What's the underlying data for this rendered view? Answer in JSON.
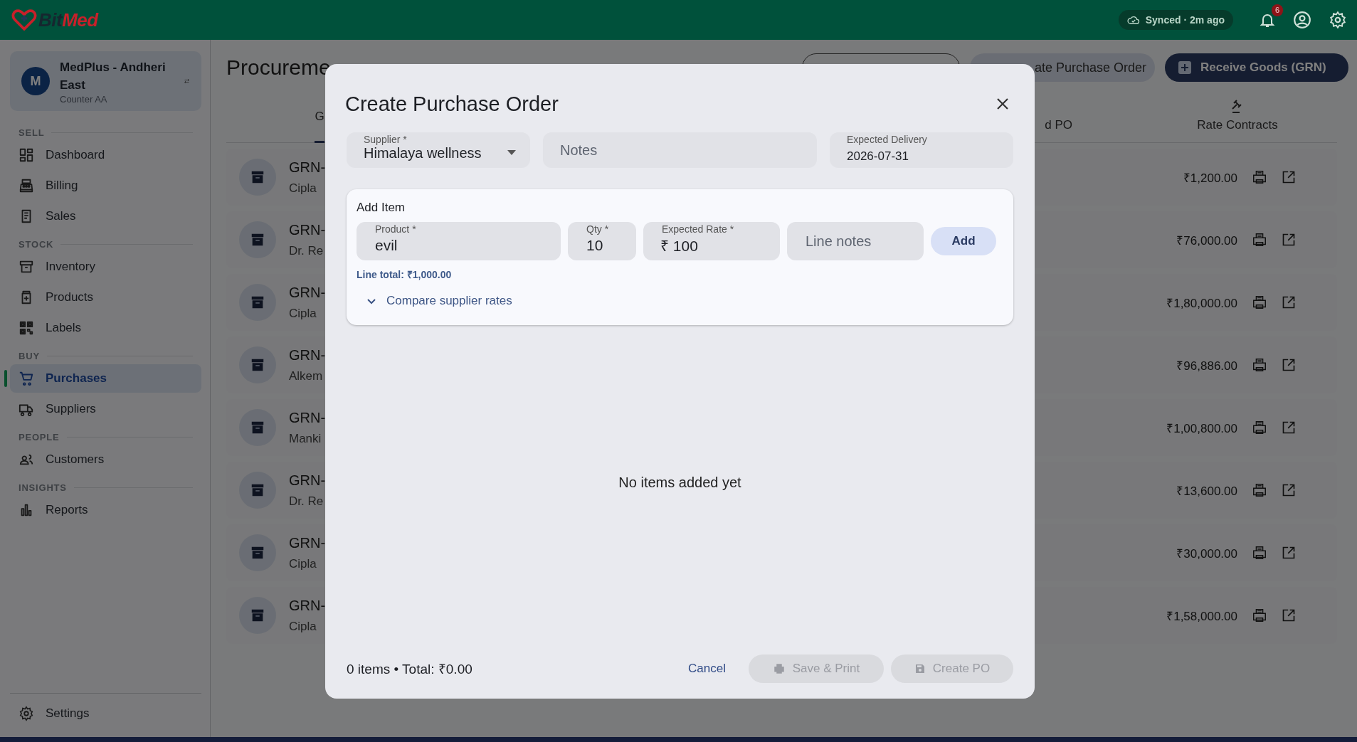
{
  "app_bar": {
    "logo": [
      "Bit",
      "Med"
    ],
    "sync_status": "Synced · 2m ago",
    "notification_count": "6"
  },
  "sidebar": {
    "store": {
      "avatar": "M",
      "name": "MedPlus - Andheri East",
      "counter": "Counter AA"
    },
    "sections": [
      {
        "title": "SELL",
        "items": [
          {
            "label": "Dashboard",
            "selected": false
          },
          {
            "label": "Billing",
            "selected": false
          },
          {
            "label": "Sales",
            "selected": false
          }
        ]
      },
      {
        "title": "STOCK",
        "items": [
          {
            "label": "Inventory",
            "selected": false
          },
          {
            "label": "Products",
            "selected": false
          },
          {
            "label": "Labels",
            "selected": false
          }
        ]
      },
      {
        "title": "BUY",
        "items": [
          {
            "label": "Purchases",
            "selected": true
          },
          {
            "label": "Suppliers",
            "selected": false
          }
        ]
      },
      {
        "title": "PEOPLE",
        "items": [
          {
            "label": "Customers",
            "selected": false
          }
        ]
      },
      {
        "title": "INSIGHTS",
        "items": [
          {
            "label": "Reports",
            "selected": false
          }
        ]
      }
    ],
    "footer_item": {
      "label": "Settings"
    }
  },
  "page": {
    "title": "Procureme",
    "actions": [
      {
        "kind": "outlined"
      },
      {
        "kind": "tonal",
        "label": "ate Purchase Order"
      },
      {
        "kind": "filled",
        "label": "Receive Goods (GRN)"
      }
    ]
  },
  "tabs": [
    {
      "label": "G",
      "selected": true
    },
    {
      "label": "d PO",
      "selected": false
    },
    {
      "label": "Rate Contracts",
      "selected": false
    }
  ],
  "rows": [
    {
      "number": "GRN-",
      "supplier": "Cipla",
      "amount": "₹1,200.00"
    },
    {
      "number": "GRN-",
      "supplier": "Dr. Re",
      "amount": "₹76,000.00"
    },
    {
      "number": "GRN-",
      "supplier": "Cipla",
      "amount": "₹1,80,000.00"
    },
    {
      "number": "GRN-",
      "supplier": "Alkem",
      "amount": "₹96,886.00"
    },
    {
      "number": "GRN-",
      "supplier": "Manki",
      "amount": "₹1,00,800.00"
    },
    {
      "number": "GRN-",
      "supplier": "Dr. Re",
      "amount": "₹13,600.00"
    },
    {
      "number": "GRN-",
      "supplier": "Cipla",
      "amount": "₹30,000.00"
    },
    {
      "number": "GRN-",
      "supplier": "Cipla",
      "amount": "₹1,58,000.00"
    }
  ],
  "dialog": {
    "title": "Create Purchase Order",
    "supplier": {
      "label": "Supplier *",
      "value": "Himalaya wellness"
    },
    "notes": {
      "placeholder": "Notes"
    },
    "expected_delivery": {
      "label": "Expected Delivery",
      "value": "2026-07-31"
    },
    "add_item": {
      "title": "Add Item",
      "product": {
        "label": "Product *",
        "value": "evil"
      },
      "qty": {
        "label": "Qty *",
        "value": "10"
      },
      "rate": {
        "label": "Expected Rate *",
        "prefix": "₹",
        "value": "100"
      },
      "line_notes": {
        "placeholder": "Line notes"
      },
      "add_button": "Add",
      "line_total": "Line total: ₹1,000.00",
      "compare_toggle": {
        "label": "Compare supplier rates",
        "expanded": false
      }
    },
    "empty_message": "No items added yet",
    "summary": "0 items • Total: ₹0.00",
    "buttons": [
      {
        "label": "Cancel",
        "kind": "text",
        "disabled": false
      },
      {
        "label": "Save & Print",
        "kind": "print",
        "disabled": true
      },
      {
        "label": "Create PO",
        "kind": "save",
        "disabled": true
      }
    ]
  }
}
